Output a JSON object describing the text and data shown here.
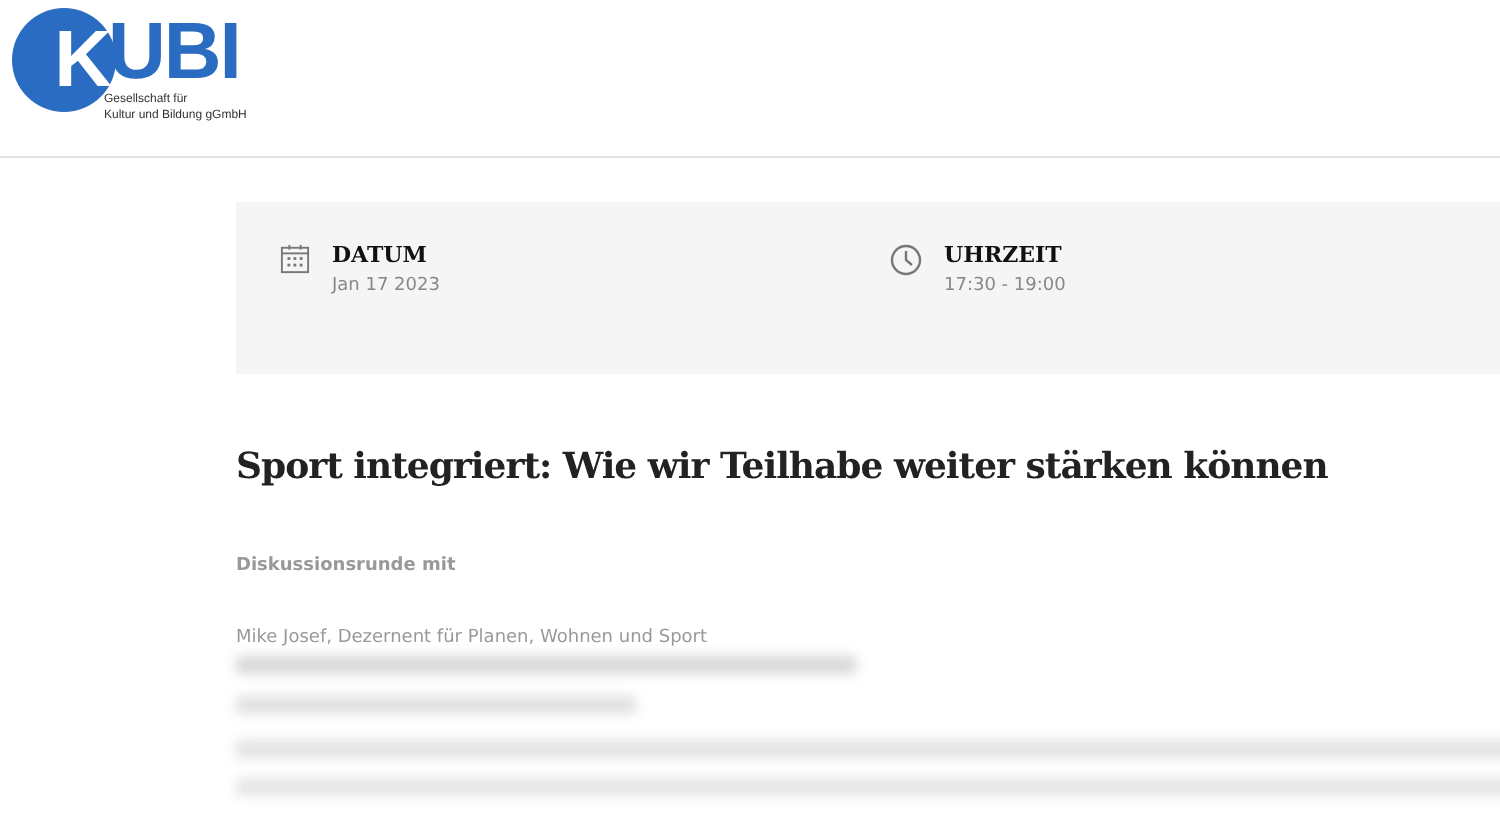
{
  "logo": {
    "mark": "K",
    "wordmark": "UBI",
    "tagline": [
      "Gesellschaft für",
      "Kultur und Bildung gGmbH"
    ]
  },
  "info": [
    {
      "kind": "date",
      "label": "DATUM",
      "value": "Jan 17 2023"
    },
    {
      "kind": "time",
      "label": "UHRZEIT",
      "value": "17:30 - 19:00"
    }
  ],
  "title": "Sport integriert: Wie wir Teilhabe weiter stärken können",
  "intro": "Diskussionsrunde mit",
  "body": [
    "Mike Josef, Dezernent für Planen, Wohnen und Sport"
  ]
}
